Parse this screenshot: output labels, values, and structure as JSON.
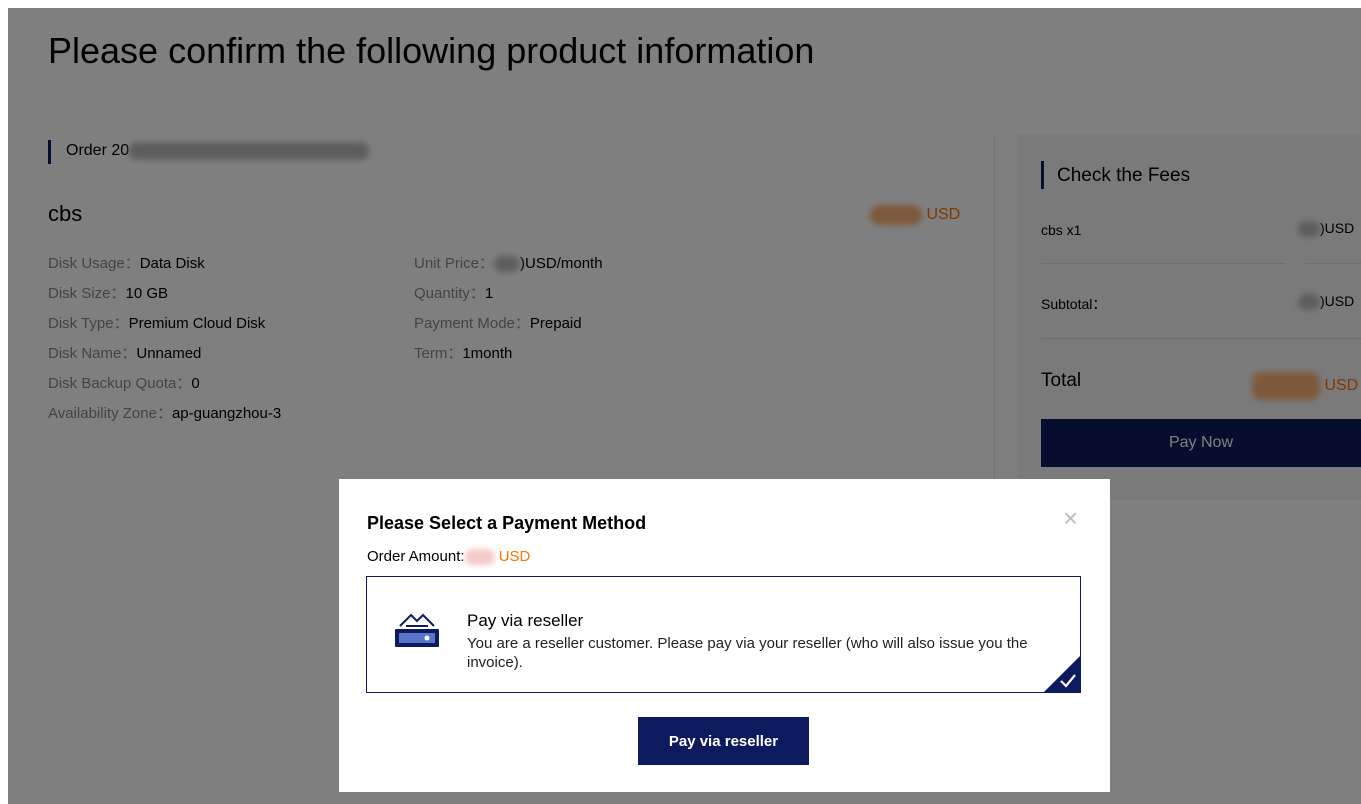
{
  "page": {
    "title": "Please confirm the following product information"
  },
  "order": {
    "label_prefix": "Order 20"
  },
  "product": {
    "name": "cbs",
    "price_currency": "USD",
    "specs_left": [
      {
        "key": "Disk Usage：",
        "value": "Data Disk"
      },
      {
        "key": "Disk Size：",
        "value": "10 GB"
      },
      {
        "key": "Disk Type：",
        "value": "Premium Cloud Disk"
      },
      {
        "key": "Disk Name：",
        "value": "Unnamed"
      },
      {
        "key": "Disk Backup Quota：",
        "value": "0"
      },
      {
        "key": "Availability Zone：",
        "value": "ap-guangzhou-3"
      }
    ],
    "specs_right": [
      {
        "key": "Unit Price：",
        "value": ")USD/month"
      },
      {
        "key": "Quantity：",
        "value": "1"
      },
      {
        "key": "Payment Mode：",
        "value": "Prepaid"
      },
      {
        "key": "Term：",
        "value": "1month"
      }
    ]
  },
  "fees": {
    "title": "Check the Fees",
    "item_label": "cbs x1",
    "item_value": ")USD",
    "subtotal_label": "Subtotal：",
    "subtotal_value": ")USD",
    "total_label": "Total",
    "total_currency": "USD",
    "pay_now_label": "Pay Now"
  },
  "modal": {
    "title": "Please Select a Payment Method",
    "order_amount_label": "Order Amount:",
    "order_amount_currency": "USD",
    "close_glyph": "×",
    "option": {
      "title": "Pay via reseller",
      "description": "You are a reseller customer. Please pay via your reseller (who will also issue you the invoice).",
      "selected": true,
      "icon": "payment-card-icon"
    },
    "confirm_label": "Pay via reseller"
  },
  "colors": {
    "brand_navy": "#0d1b5e",
    "price_orange": "#ff7200"
  }
}
